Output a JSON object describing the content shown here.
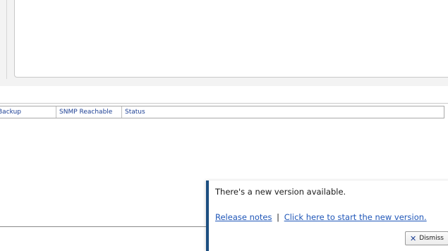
{
  "grid": {
    "columns": [
      "Backup",
      "SNMP Reachable",
      "Status"
    ]
  },
  "notification": {
    "message": "There's a new version available.",
    "release_notes": "Release notes",
    "separator": "|",
    "start_new_version": "Click here to start the new version.",
    "dismiss_label": "Dismiss",
    "dismiss_icon": "close-icon",
    "accent_color": "#1c4e80",
    "link_color": "#1f56b8"
  }
}
